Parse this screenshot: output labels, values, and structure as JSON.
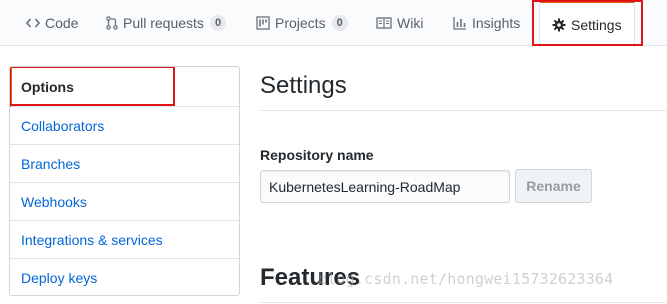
{
  "tabs": [
    {
      "label": "Code",
      "icon": "code-icon"
    },
    {
      "label": "Pull requests",
      "icon": "pull-request-icon",
      "count": "0"
    },
    {
      "label": "Projects",
      "icon": "project-icon",
      "count": "0"
    },
    {
      "label": "Wiki",
      "icon": "book-icon"
    },
    {
      "label": "Insights",
      "icon": "graph-icon"
    },
    {
      "label": "Settings",
      "icon": "gear-icon",
      "selected": true
    }
  ],
  "sidebar": {
    "items": [
      {
        "label": "Options",
        "selected": true
      },
      {
        "label": "Collaborators"
      },
      {
        "label": "Branches"
      },
      {
        "label": "Webhooks"
      },
      {
        "label": "Integrations & services"
      },
      {
        "label": "Deploy keys"
      }
    ]
  },
  "main": {
    "title": "Settings",
    "repo_name_label": "Repository name",
    "repo_name_value": "KubernetesLearning-RoadMap",
    "rename_label": "Rename",
    "features_title": "Features"
  },
  "watermark": "blog.csdn.net/hongwei15732623364",
  "colors": {
    "accent": "#e36209",
    "link": "#0366d6",
    "highlight_box": "#e01414"
  }
}
